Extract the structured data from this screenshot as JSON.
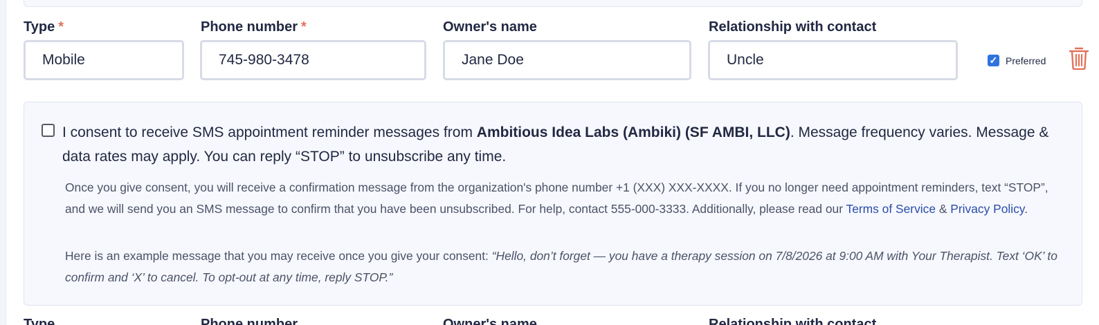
{
  "fields": {
    "type": {
      "label": "Type",
      "required": "*",
      "value": "Mobile"
    },
    "phone": {
      "label": "Phone number",
      "required": "*",
      "value": "745-980-3478"
    },
    "owner": {
      "label": "Owner's name",
      "value": "Jane Doe"
    },
    "relationship": {
      "label": "Relationship with contact",
      "value": "Uncle"
    }
  },
  "preferred": {
    "label": "Preferred",
    "checked": true,
    "check_glyph": "✓"
  },
  "delete_icon": "trash-icon",
  "consent": {
    "checked": false,
    "text_before": "I consent to receive SMS appointment reminder messages from ",
    "org_name": "Ambitious Idea Labs (Ambiki) (SF AMBI, LLC)",
    "text_after": ". Message frequency varies. Message & data rates may apply. You can reply “STOP” to unsubscribe any time.",
    "detail_text": "Once you give consent, you will receive a confirmation message from the organization's phone number +1 (XXX) XXX-XXXX. If you no longer need appointment reminders, text “STOP”, and we will send you an SMS message to confirm that you have been unsubscribed. For help, contact 555-000-3333. Additionally, please read our ",
    "terms_link": "Terms of Service",
    "ampersand": " & ",
    "privacy_link": "Privacy Policy",
    "period": ".",
    "example_intro": "Here is an example message that you may receive once you give your consent: ",
    "example_message": "“Hello, don’t forget — you have a therapy session on 7/8/2026 at 9:00 AM with Your Therapist. Text ‘OK’ to confirm and ‘X’ to cancel. To opt-out at any time, reply STOP.”"
  },
  "colors": {
    "accent": "#2f73e0",
    "required": "#e2725b",
    "delete": "#e2725b",
    "link": "#2b4da8",
    "panel": "#f6f8fe"
  }
}
